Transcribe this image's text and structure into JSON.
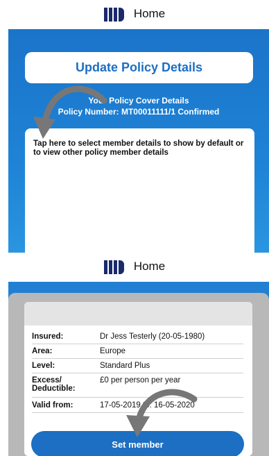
{
  "header": {
    "home_label": "Home",
    "logo": "mp-logo-icon"
  },
  "screen1": {
    "update_button": "Update Policy Details",
    "cover_title": "Your Policy Cover Details",
    "policy_number": "Policy Number: MT00011111/1 Confirmed",
    "member_hint": "Tap here to select member details to show by default or to view other policy member details"
  },
  "screen2": {
    "rows": [
      {
        "label": "Insured:",
        "value": "Dr Jess Testerly (20-05-1980)"
      },
      {
        "label": "Area:",
        "value": "Europe"
      },
      {
        "label": "Level:",
        "value": "Standard Plus"
      },
      {
        "label": "Excess/ Deductible:",
        "value": "£0 per person per year"
      },
      {
        "label": "Valid from:",
        "value": "17-05-2019 to: 16-05-2020"
      }
    ],
    "set_member_button": "Set member"
  },
  "colors": {
    "primary": "#1c6fc2",
    "panel": "#1e83d6",
    "logo": "#1a2b6b"
  }
}
